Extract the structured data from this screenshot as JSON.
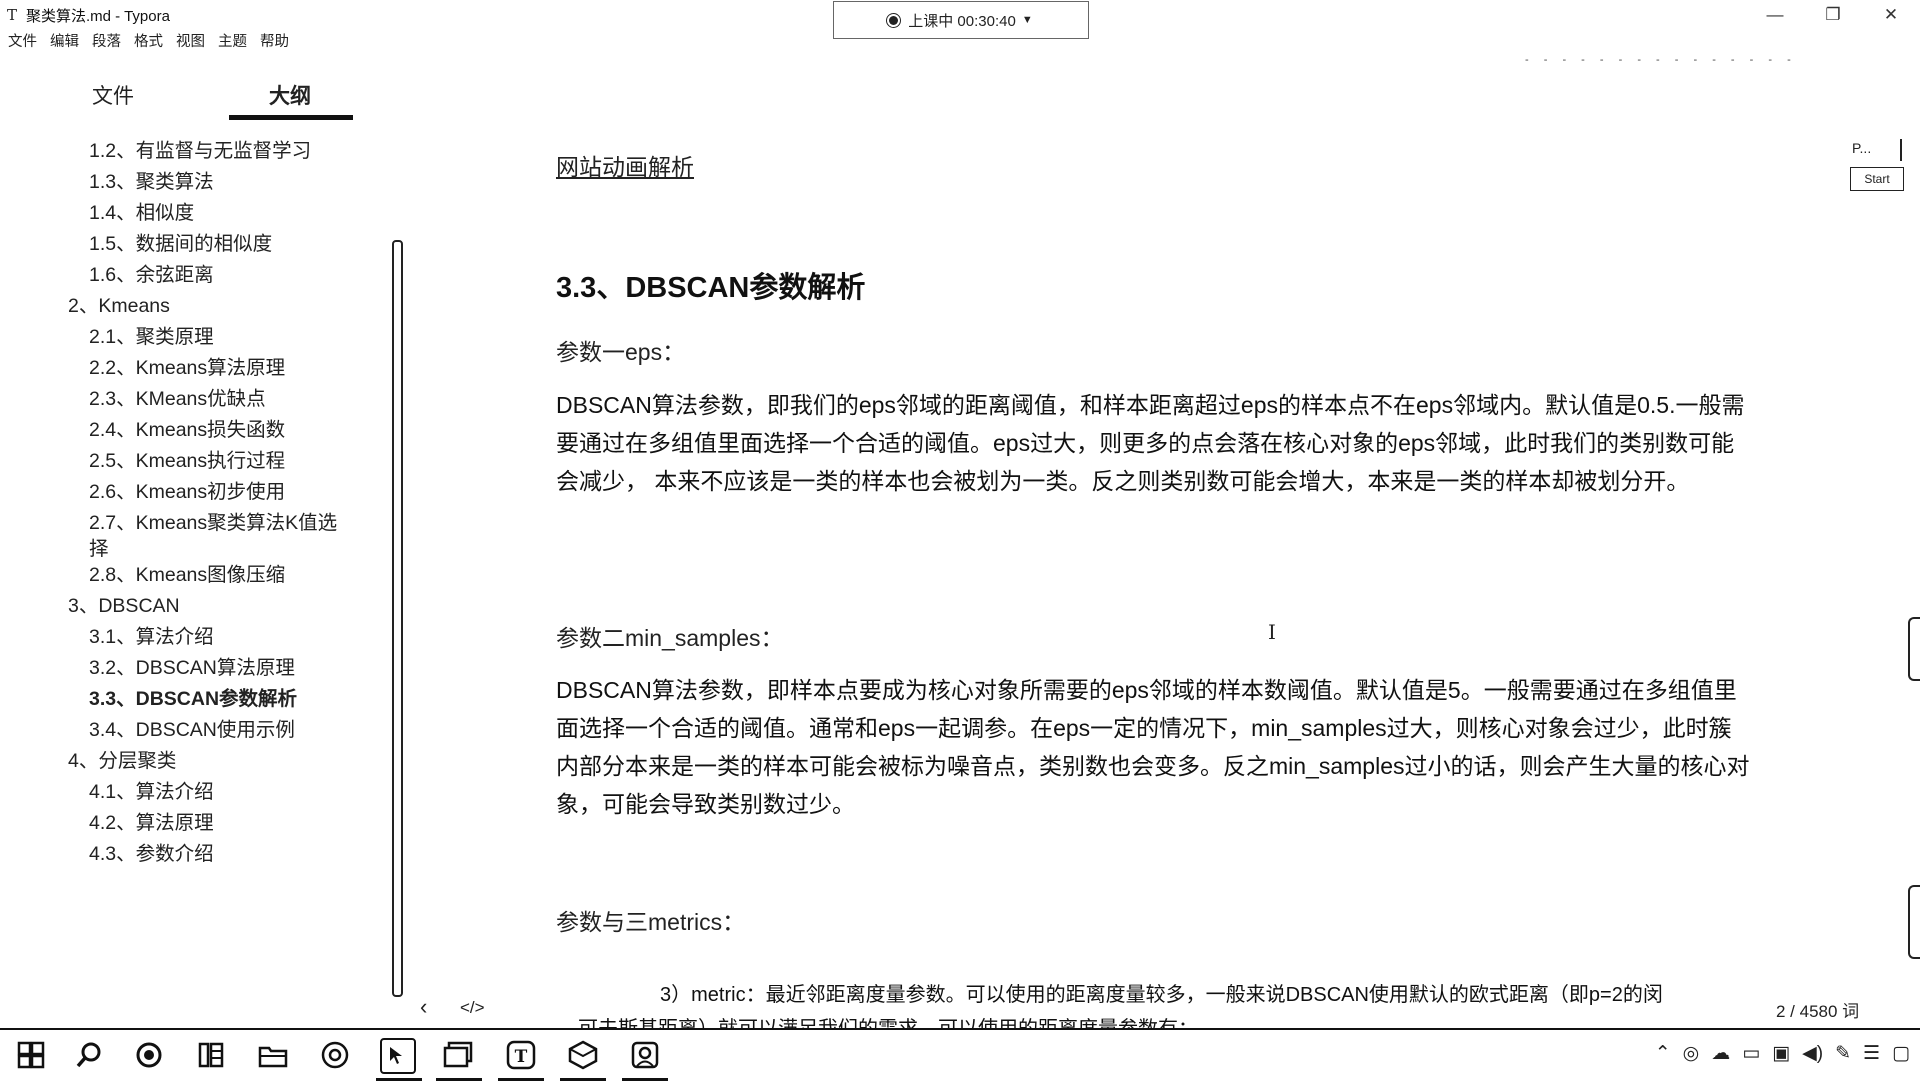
{
  "window": {
    "app_icon": "T",
    "title": "聚类算法.md - Typora",
    "minimize": "—",
    "maximize": "❐",
    "close": "✕"
  },
  "classbar": {
    "text": "上课中 00:30:40"
  },
  "menu": [
    "文件",
    "编辑",
    "段落",
    "格式",
    "视图",
    "主题",
    "帮助"
  ],
  "sidebar": {
    "tab_files": "文件",
    "tab_outline": "大纲",
    "items": [
      {
        "label": "1.2、有监督与无监督学习",
        "indent": 2
      },
      {
        "label": "1.3、聚类算法",
        "indent": 2
      },
      {
        "label": "1.4、相似度",
        "indent": 2
      },
      {
        "label": "1.5、数据间的相似度",
        "indent": 2
      },
      {
        "label": "1.6、余弦距离",
        "indent": 2
      },
      {
        "label": "2、Kmeans",
        "indent": 1
      },
      {
        "label": "2.1、聚类原理",
        "indent": 2
      },
      {
        "label": "2.2、Kmeans算法原理",
        "indent": 2
      },
      {
        "label": "2.3、KMeans优缺点",
        "indent": 2
      },
      {
        "label": "2.4、Kmeans损失函数",
        "indent": 2
      },
      {
        "label": "2.5、Kmeans执行过程",
        "indent": 2
      },
      {
        "label": "2.6、Kmeans初步使用",
        "indent": 2
      },
      {
        "label": "2.7、Kmeans聚类算法K值选择",
        "indent": 2
      },
      {
        "label": "2.8、Kmeans图像压缩",
        "indent": 2
      },
      {
        "label": "3、DBSCAN",
        "indent": 1
      },
      {
        "label": "3.1、算法介绍",
        "indent": 2
      },
      {
        "label": "3.2、DBSCAN算法原理",
        "indent": 2
      },
      {
        "label": "3.3、DBSCAN参数解析",
        "indent": 2,
        "active": true
      },
      {
        "label": "3.4、DBSCAN使用示例",
        "indent": 2
      },
      {
        "label": "4、分层聚类",
        "indent": 1
      },
      {
        "label": "4.1、算法介绍",
        "indent": 2
      },
      {
        "label": "4.2、算法原理",
        "indent": 2
      },
      {
        "label": "4.3、参数介绍",
        "indent": 2
      }
    ],
    "prev_glyph": "‹",
    "source_glyph": "</>"
  },
  "doc": {
    "link": "网站动画解析",
    "heading": "3.3、DBSCAN参数解析",
    "param1_label": "参数一eps：",
    "param1_text": "DBSCAN算法参数，即我们的eps邻域的距离阈值，和样本距离超过eps的样本点不在eps邻域内。默认值是0.5.一般需要通过在多组值里面选择一个合适的阈值。eps过大，则更多的点会落在核心对象的eps邻域，此时我们的类别数可能会减少， 本来不应该是一类的样本也会被划为一类。反之则类别数可能会增大，本来是一类的样本却被划分开。",
    "param2_label": "参数二min_samples：",
    "param2_text": "DBSCAN算法参数，即样本点要成为核心对象所需要的eps邻域的样本数阈值。默认值是5。一般需要通过在多组值里面选择一个合适的阈值。通常和eps一起调参。在eps一定的情况下，min_samples过大，则核心对象会过少，此时簇内部分本来是一类的样本可能会被标为噪音点，类别数也会变多。反之min_samples过小的话，则会产生大量的核心对象，可能会导致类别数过少。",
    "param3_label": "参数与三metrics：",
    "metric_line": "3）metric：最近邻距离度量参数。可以使用的距离度量较多，一般来说DBSCAN使用默认的欧式距离（即p=2的闵",
    "metric_line2": "可夫斯基距离）就可以满足我们的需求。可以使用的距离度量参数有："
  },
  "right_panel": {
    "label": "P...",
    "start": "Start"
  },
  "status": {
    "wordcount": "2 / 4580 词"
  },
  "taskbar": {
    "icons": [
      "windows-icon",
      "search-icon",
      "record-icon",
      "files-icon",
      "folder-icon",
      "browser-icon",
      "pointer-app-icon",
      "slides-icon",
      "typora-icon",
      "package-icon",
      "pictures-icon"
    ]
  }
}
